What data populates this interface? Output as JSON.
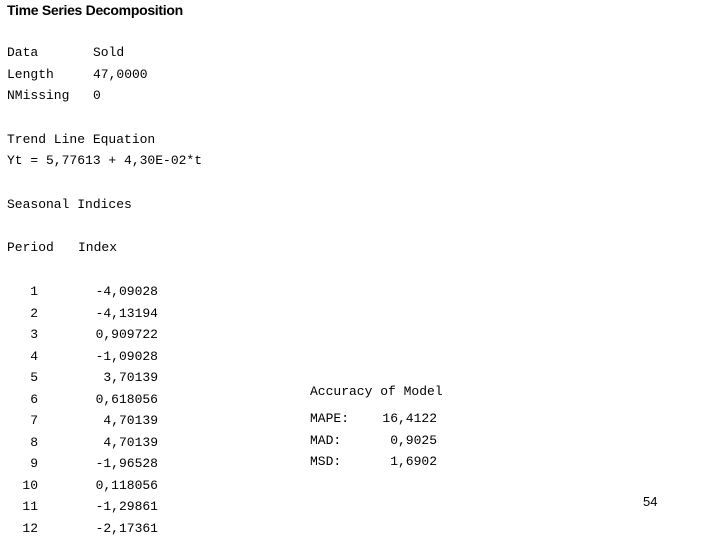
{
  "report": {
    "title": "Time Series Decomposition",
    "page_number": "54"
  },
  "summary": {
    "rows": [
      {
        "label": "Data",
        "value": "Sold"
      },
      {
        "label": "Length",
        "value": "47,0000"
      },
      {
        "label": "NMissing",
        "value": "0"
      }
    ]
  },
  "trend": {
    "heading": "Trend Line Equation",
    "equation": "Yt = 5,77613 + 4,30E-02*t"
  },
  "seasonal": {
    "heading": "Seasonal Indices",
    "col_period": "Period",
    "col_index": "Index",
    "rows": [
      {
        "period": "1",
        "index": "-4,09028"
      },
      {
        "period": "2",
        "index": "-4,13194"
      },
      {
        "period": "3",
        "index": "0,909722"
      },
      {
        "period": "4",
        "index": "-1,09028"
      },
      {
        "period": "5",
        "index": "3,70139"
      },
      {
        "period": "6",
        "index": "0,618056"
      },
      {
        "period": "7",
        "index": "4,70139"
      },
      {
        "period": "8",
        "index": "4,70139"
      },
      {
        "period": "9",
        "index": "-1,96528"
      },
      {
        "period": "10",
        "index": "0,118056"
      },
      {
        "period": "11",
        "index": "-1,29861"
      },
      {
        "period": "12",
        "index": "-2,17361"
      }
    ]
  },
  "accuracy": {
    "heading": "Accuracy of Model",
    "rows": [
      {
        "label": "MAPE:",
        "value": "16,4122"
      },
      {
        "label": "MAD:",
        "value": "0,9025"
      },
      {
        "label": "MSD:",
        "value": "1,6902"
      }
    ]
  },
  "chart_data": {
    "type": "table",
    "title": "Time Series Decomposition",
    "series_name": "Sold",
    "length": 47,
    "n_missing": 0,
    "trend_equation": "Yt = 5,77613 + 4,30E-02*t",
    "trend_intercept": 5.77613,
    "trend_slope": 0.043,
    "categories": [
      "1",
      "2",
      "3",
      "4",
      "5",
      "6",
      "7",
      "8",
      "9",
      "10",
      "11",
      "12"
    ],
    "xlabel": "Period",
    "ylabel": "Index",
    "values": [
      -4.09028,
      -4.13194,
      0.909722,
      -1.09028,
      3.70139,
      0.618056,
      4.70139,
      4.70139,
      -1.96528,
      0.118056,
      -1.29861,
      -2.17361
    ],
    "accuracy": {
      "MAPE": 16.4122,
      "MAD": 0.9025,
      "MSD": 1.6902
    }
  }
}
